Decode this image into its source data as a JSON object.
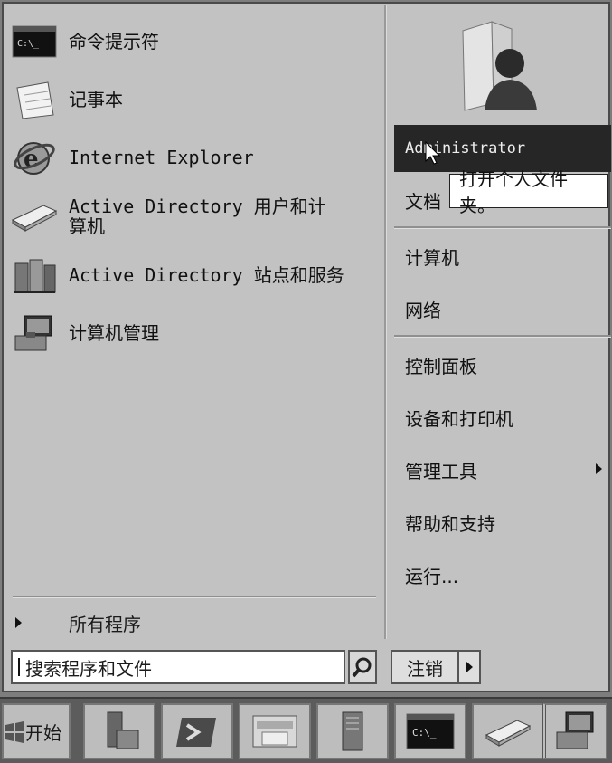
{
  "programs": [
    {
      "label": "命令提示符",
      "icon": "command-prompt-icon"
    },
    {
      "label": "记事本",
      "icon": "notepad-icon"
    },
    {
      "label": "Internet Explorer",
      "icon": "internet-explorer-icon"
    },
    {
      "label": "Active Directory 用户和计算机",
      "icon": "ad-users-computers-icon"
    },
    {
      "label": "Active Directory 站点和服务",
      "icon": "ad-sites-services-icon"
    },
    {
      "label": "计算机管理",
      "icon": "computer-management-icon"
    }
  ],
  "all_programs_label": "所有程序",
  "search": {
    "placeholder": "搜索程序和文件",
    "value": "搜索程序和文件"
  },
  "right_pane": {
    "user_name": "Administrator",
    "tooltip": "打开个人文件夹。",
    "items": [
      {
        "label": "文档"
      },
      {
        "label": "计算机"
      },
      {
        "label": "网络"
      },
      {
        "label": "控制面板"
      },
      {
        "label": "设备和打印机"
      },
      {
        "label": "管理工具"
      },
      {
        "label": "帮助和支持"
      },
      {
        "label": "运行..."
      }
    ]
  },
  "logoff_label": "注销",
  "taskbar": {
    "start_label": "开始",
    "buttons": [
      "server-manager-icon",
      "powershell-icon",
      "explorer-icon",
      "admin-tools-icon",
      "command-prompt-icon",
      "ad-users-computers-icon",
      "computer-management-icon"
    ]
  },
  "colors": {
    "menu_bg": "#c2c2c2",
    "highlight": "#262626",
    "taskbar": "#5c5c5c"
  }
}
